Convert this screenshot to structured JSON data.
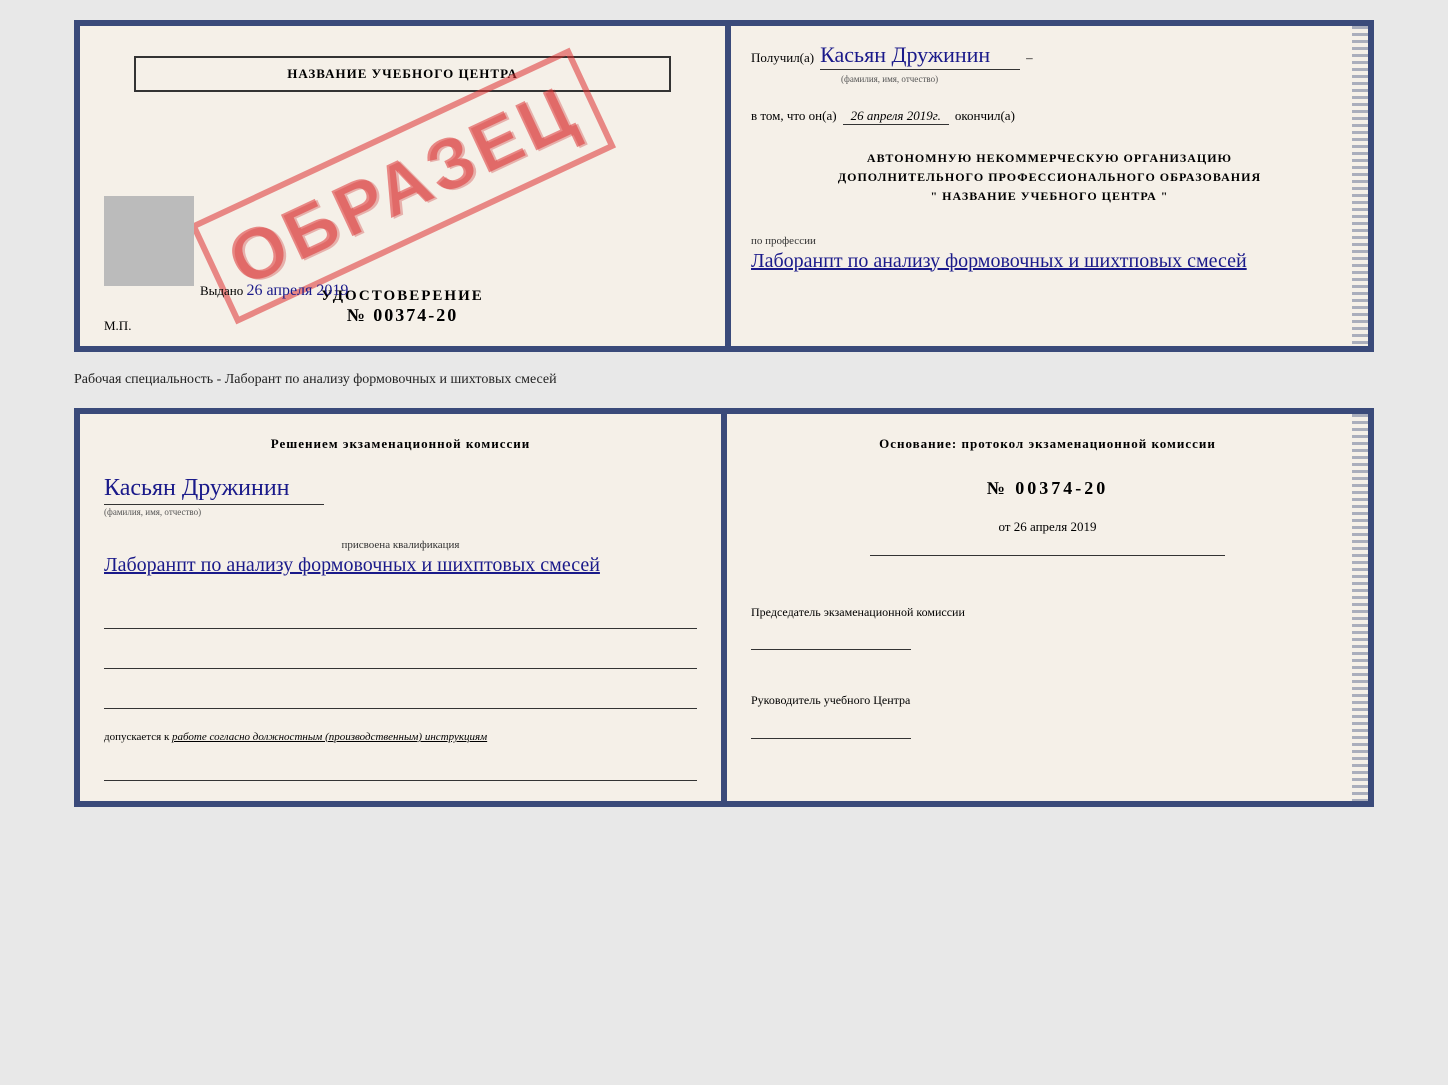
{
  "top_doc": {
    "left": {
      "school_name": "НАЗВАНИЕ УЧЕБНОГО ЦЕНТРА",
      "cert_label": "УДОСТОВЕРЕНИЕ",
      "cert_number": "№ 00374-20",
      "stamp_text": "ОБРАЗЕЦ",
      "issued_label": "Выдано",
      "issued_date": "26 апреля 2019",
      "mp_label": "М.П."
    },
    "right": {
      "received_prefix": "Получил(а)",
      "received_name": "Касьян Дружинин",
      "received_name_sublabel": "(фамилия, имя, отчество)",
      "date_prefix": "в том, что он(а)",
      "date_value": "26 апреля 2019г.",
      "date_suffix": "окончил(а)",
      "org_line1": "АВТОНОМНУЮ НЕКОММЕРЧЕСКУЮ ОРГАНИЗАЦИЮ",
      "org_line2": "ДОПОЛНИТЕЛЬНОГО ПРОФЕССИОНАЛЬНОГО ОБРАЗОВАНИЯ",
      "org_line3": "\"  НАЗВАНИЕ УЧЕБНОГО ЦЕНТРА  \"",
      "profession_prefix": "по профессии",
      "profession_value": "Лаборанпт по анализу формовочных и шихтповых смесей"
    }
  },
  "specialty_line": "Рабочая специальность - Лаборант по анализу формовочных и шихтовых смесей",
  "bottom_doc": {
    "left": {
      "commission_header": "Решением  экзаменационной  комиссии",
      "person_name": "Касьян  Дружинин",
      "person_sublabel": "(фамилия, имя, отчество)",
      "qualification_prefix": "присвоена квалификация",
      "qualification_value": "Лаборанпт по анализу формовочных и шихптовых смесей",
      "допускается_prefix": "допускается к",
      "допускается_value": "работе согласно должностным (производственным) инструкциям"
    },
    "right": {
      "osnov_header": "Основание: протокол экзаменационной  комиссии",
      "protocol_number": "№  00374-20",
      "from_label": "от",
      "from_date": "26 апреля 2019",
      "chairman_label": "Председатель экзаменационной комиссии",
      "director_label": "Руководитель учебного Центра"
    }
  }
}
